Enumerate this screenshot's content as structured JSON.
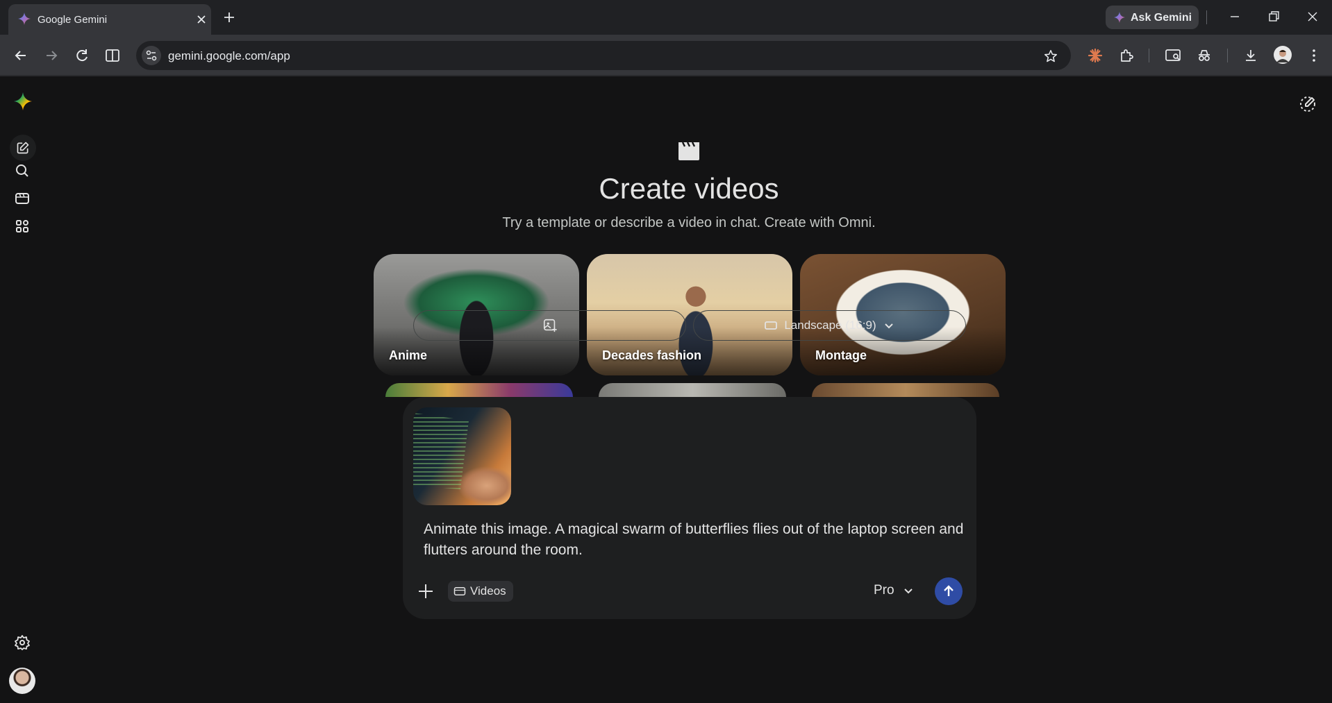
{
  "browser": {
    "tab_title": "Google Gemini",
    "ask_gemini_label": "Ask Gemini",
    "url": "gemini.google.com/app"
  },
  "page": {
    "headline": "Create videos",
    "subhead": "Try a template or describe a video in chat. Create with Omni.",
    "templates": [
      {
        "label": "Anime"
      },
      {
        "label": "Decades fashion"
      },
      {
        "label": "Montage"
      }
    ]
  },
  "composer": {
    "prompt": "Animate this image. A magical swarm of butterflies flies out of the laptop screen and flutters around the room.",
    "tool_chip": "Videos",
    "model": "Pro",
    "aspect_ratio": "Landscape (16:9)"
  },
  "colors": {
    "background": "#131314",
    "composer": "#1e1f20",
    "send_button": "#2f4ca5"
  }
}
